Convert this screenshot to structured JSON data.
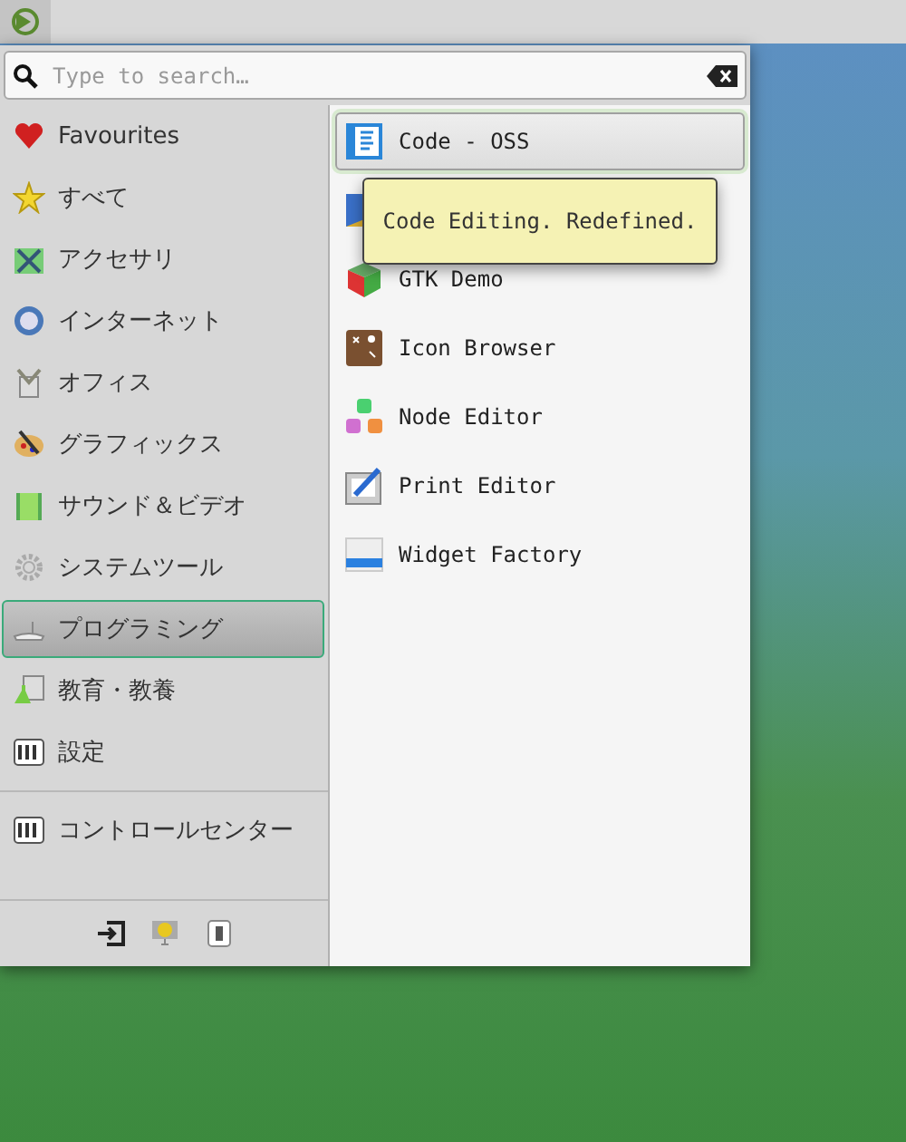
{
  "search": {
    "placeholder": "Type to search…"
  },
  "categories": [
    {
      "label": "Favourites",
      "selected": false
    },
    {
      "label": "すべて",
      "selected": false
    },
    {
      "label": "アクセサリ",
      "selected": false
    },
    {
      "label": "インターネット",
      "selected": false
    },
    {
      "label": "オフィス",
      "selected": false
    },
    {
      "label": "グラフィックス",
      "selected": false
    },
    {
      "label": "サウンド＆ビデオ",
      "selected": false
    },
    {
      "label": "システムツール",
      "selected": false
    },
    {
      "label": "プログラミング",
      "selected": true
    },
    {
      "label": "教育・教養",
      "selected": false
    },
    {
      "label": "設定",
      "selected": false
    }
  ],
  "extra_categories": [
    {
      "label": "コントロールセンター",
      "selected": false
    }
  ],
  "apps": [
    {
      "label": "Code - OSS",
      "selected": true
    },
    {
      "selected": false
    },
    {
      "label": "GTK Demo",
      "selected": false
    },
    {
      "label": "Icon Browser",
      "selected": false
    },
    {
      "label": "Node Editor",
      "selected": false
    },
    {
      "label": "Print Editor",
      "selected": false
    },
    {
      "label": "Widget Factory",
      "selected": false
    }
  ],
  "tooltip": "Code Editing. Redefined."
}
